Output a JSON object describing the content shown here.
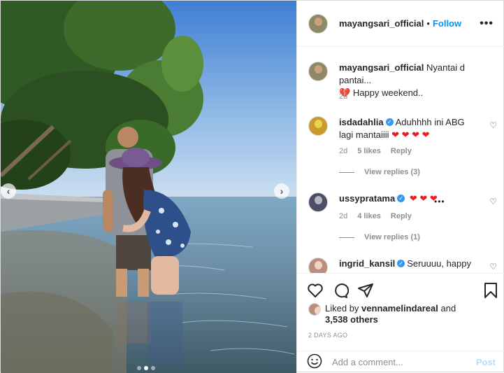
{
  "header": {
    "username": "mayangsari_official",
    "separator": "•",
    "follow_label": "Follow",
    "more_label": "•••"
  },
  "caption": {
    "username": "mayangsari_official",
    "text": "Nyantai d pantai...",
    "text2": "Happy weekend..",
    "heart": "💔",
    "time": "2d"
  },
  "comments": [
    {
      "username": "isdadahlia",
      "verified": true,
      "text": "Aduhhhh ini ABG lagi mantaiiii",
      "hearts": "❤ ❤ ❤ ❤",
      "time": "2d",
      "likes": "5 likes",
      "reply": "Reply",
      "view_replies": "View replies (3)"
    },
    {
      "username": "ussypratama",
      "verified": true,
      "text": "",
      "hearts": "❤ ❤ ❤",
      "time": "2d",
      "likes": "4 likes",
      "reply": "Reply",
      "view_replies": "View replies (1)",
      "more": "•••"
    },
    {
      "username": "ingrid_kansil",
      "verified": true,
      "text": "Seruuuu, happy"
    }
  ],
  "actions": {
    "liked_prefix": "Liked by",
    "liked_user": "vennamelindareal",
    "liked_and": "and",
    "liked_count": "3,538 others",
    "date": "2 DAYS AGO"
  },
  "add_comment": {
    "placeholder": "Add a comment...",
    "post_label": "Post",
    "emoji_icon": "smiley-icon"
  },
  "carousel": {
    "prev_label": "‹",
    "next_label": "›",
    "slides": 3,
    "active_slide": 2
  },
  "colors": {
    "link_blue": "#0095f6",
    "post_disabled": "#b2dffc",
    "verified_blue": "#3897f0",
    "meta_gray": "#8e8e8e"
  }
}
